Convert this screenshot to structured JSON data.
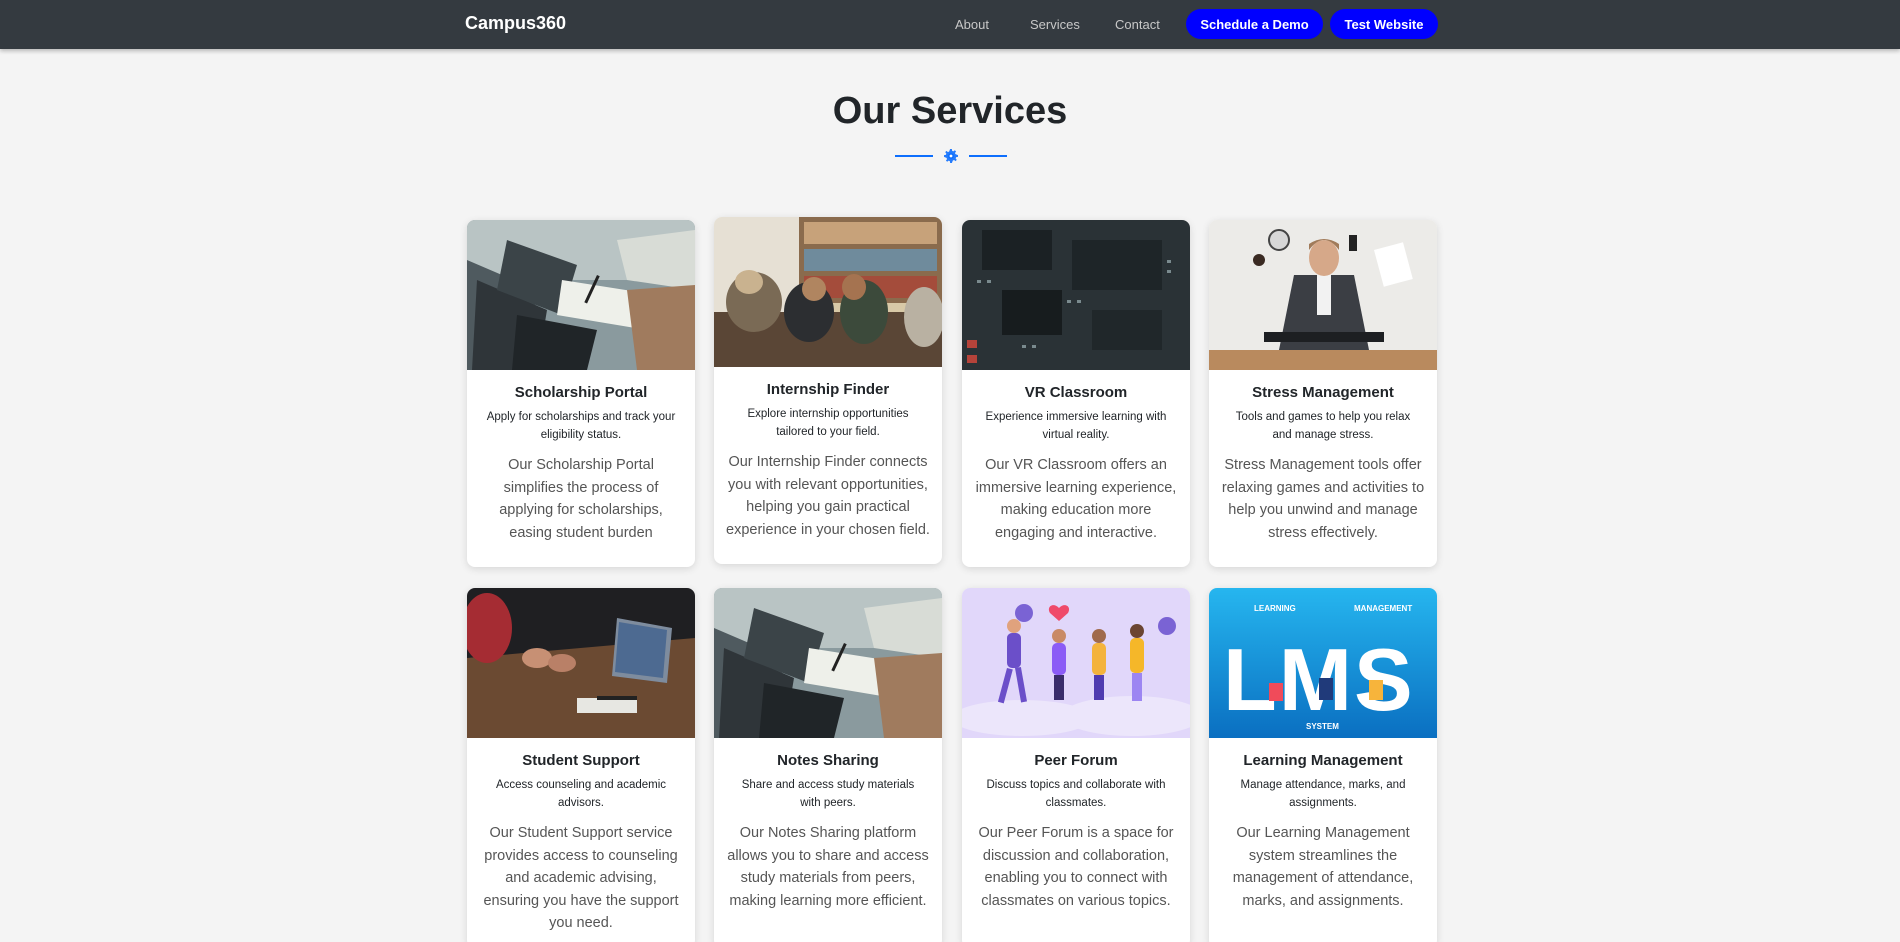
{
  "navbar": {
    "brand": "Campus360",
    "links": [
      "About",
      "Services",
      "Contact"
    ],
    "demo_button": "Schedule a Demo",
    "test_button": "Test Website"
  },
  "section": {
    "title": "Our Services",
    "divider_icon": "gear-icon",
    "accent_color": "#0d6efd"
  },
  "services": [
    {
      "title": "Scholarship Portal",
      "subtitle": "Apply for scholarships and track your eligibility status.",
      "description": "Our Scholarship Portal simplifies the process of applying for scholarships, easing student burden",
      "image": "laptop-notes-photo"
    },
    {
      "title": "Internship Finder",
      "subtitle": "Explore internship opportunities tailored to your field.",
      "description": "Our Internship Finder connects you with relevant opportunities, helping you gain practical experience in your chosen field.",
      "image": "team-office-photo"
    },
    {
      "title": "VR Classroom",
      "subtitle": "Experience immersive learning with virtual reality.",
      "description": "Our VR Classroom offers an immersive learning experience, making education more engaging and interactive.",
      "image": "circuit-board-photo"
    },
    {
      "title": "Stress Management",
      "subtitle": "Tools and games to help you relax and manage stress.",
      "description": "Stress Management tools offer relaxing games and activities to help you unwind and manage stress effectively.",
      "image": "stressed-person-photo"
    },
    {
      "title": "Student Support",
      "subtitle": "Access counseling and academic advisors.",
      "description": "Our Student Support service provides access to counseling and academic advising, ensuring you have the support you need.",
      "image": "meeting-laptop-photo"
    },
    {
      "title": "Notes Sharing",
      "subtitle": "Share and access study materials with peers.",
      "description": "Our Notes Sharing platform allows you to share and access study materials from peers, making learning more efficient.",
      "image": "laptop-notes-photo"
    },
    {
      "title": "Peer Forum",
      "subtitle": "Discuss topics and collaborate with classmates.",
      "description": "Our Peer Forum is a space for discussion and collaboration, enabling you to connect with classmates on various topics.",
      "image": "jumping-people-illustration"
    },
    {
      "title": "Learning Management",
      "subtitle": "Manage attendance, marks, and assignments.",
      "description": "Our Learning Management system streamlines the management of attendance, marks, and assignments.",
      "image": "lms-illustration",
      "image_text": [
        "LEARNING",
        "MANAGEMENT",
        "LMS",
        "SYSTEM"
      ]
    }
  ]
}
